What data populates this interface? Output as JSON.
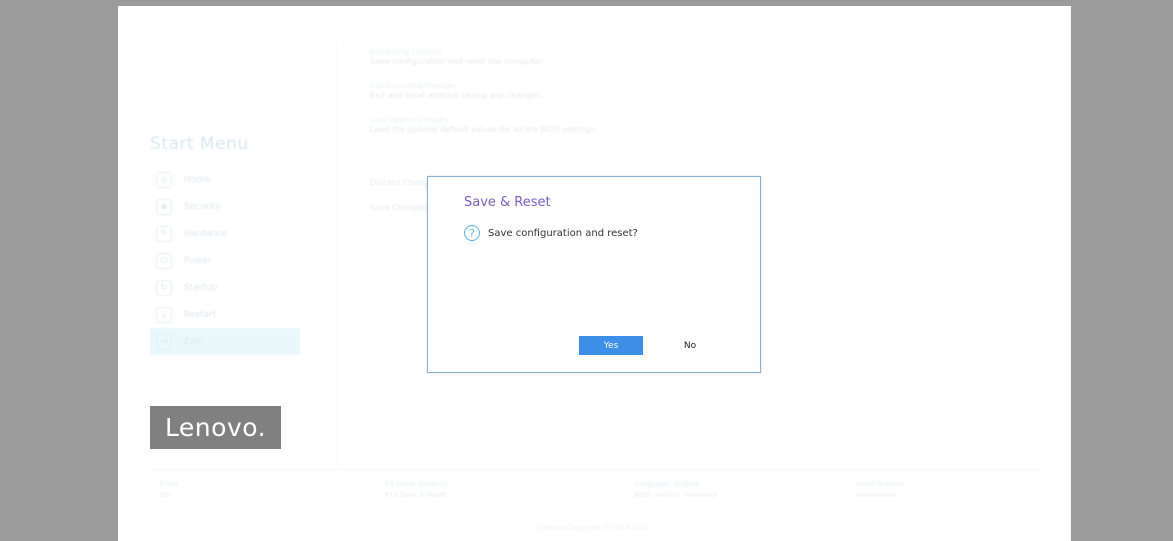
{
  "start_menu": {
    "title": "Start Menu",
    "items": [
      {
        "label": "Home",
        "icon": "home-icon"
      },
      {
        "label": "Security",
        "icon": "shield-icon"
      },
      {
        "label": "Hardware",
        "icon": "tools-icon"
      },
      {
        "label": "Power",
        "icon": "power-icon"
      },
      {
        "label": "Startup",
        "icon": "startup-icon"
      },
      {
        "label": "Restart",
        "icon": "download-icon"
      },
      {
        "label": "Exit",
        "icon": "exit-icon",
        "active": true
      }
    ]
  },
  "content": {
    "lines": [
      "Exit Saving Changes",
      "Save configuration and reset the computer.",
      "Exit Discarding Changes",
      "Exit and reset without saving any changes.",
      "Load Optimal Defaults",
      "Load the optimal default values for all the BIOS settings.",
      "Discard Changes",
      "Save Changes"
    ]
  },
  "brand": {
    "logo_text": "Lenovo."
  },
  "footer": {
    "columns": [
      [
        "Enter",
        "Esc"
      ],
      [
        "F9 Setup Defaults",
        "F10 Save & Reset"
      ],
      [
        "Language: English",
        "BIOS Version: xxxxxxxx"
      ],
      [
        "Serial Number",
        "xxxxxxxxxx"
      ]
    ],
    "copyright": "Lenovo Copyright © 2019-2020"
  },
  "dialog": {
    "title": "Save & Reset",
    "message": "Save configuration and reset?",
    "yes_label": "Yes",
    "no_label": "No",
    "icon": "question-icon"
  },
  "colors": {
    "dialog_title": "#7d5cc7",
    "yes_button": "#3d8ee6",
    "active_menu": "#c5eaf6",
    "backdrop": "#9b9b9b"
  }
}
